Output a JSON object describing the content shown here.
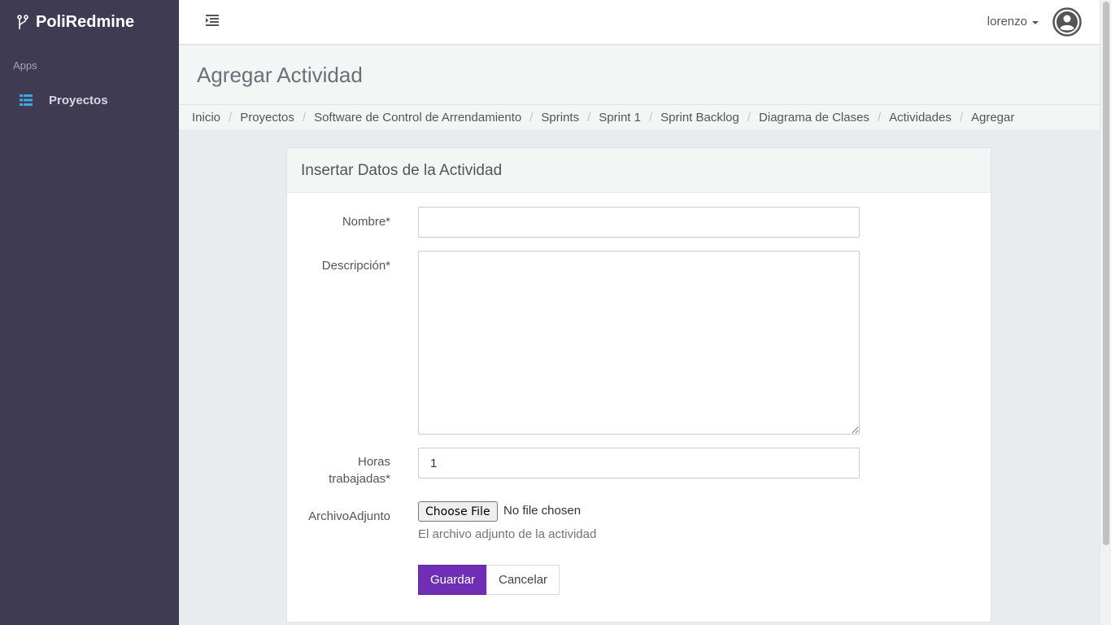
{
  "app": {
    "name": "PoliRedmine"
  },
  "sidebar": {
    "section": "Apps",
    "items": [
      {
        "label": "Proyectos",
        "icon": "list-icon"
      }
    ]
  },
  "topbar": {
    "user": "lorenzo"
  },
  "page": {
    "title": "Agregar Actividad"
  },
  "breadcrumb": [
    "Inicio",
    "Proyectos",
    "Software de Control de Arrendamiento",
    "Sprints",
    "Sprint 1",
    "Sprint Backlog",
    "Diagrama de Clases",
    "Actividades",
    "Agregar"
  ],
  "form": {
    "panel_title": "Insertar Datos de la Actividad",
    "nombre_label": "Nombre*",
    "nombre_value": "",
    "descripcion_label": "Descripción*",
    "descripcion_value": "",
    "horas_label_line1": "Horas",
    "horas_label_line2": "trabajadas*",
    "horas_value": "1",
    "archivo_label": "ArchivoAdjunto",
    "file_button": "Choose File",
    "file_status": "No file chosen",
    "archivo_help": "El archivo adjunto de la actividad",
    "save_label": "Guardar",
    "cancel_label": "Cancelar"
  },
  "colors": {
    "sidebar_bg": "#3e3b53",
    "accent": "#6f2fb5",
    "sidebar_icon": "#3fa7e6"
  }
}
